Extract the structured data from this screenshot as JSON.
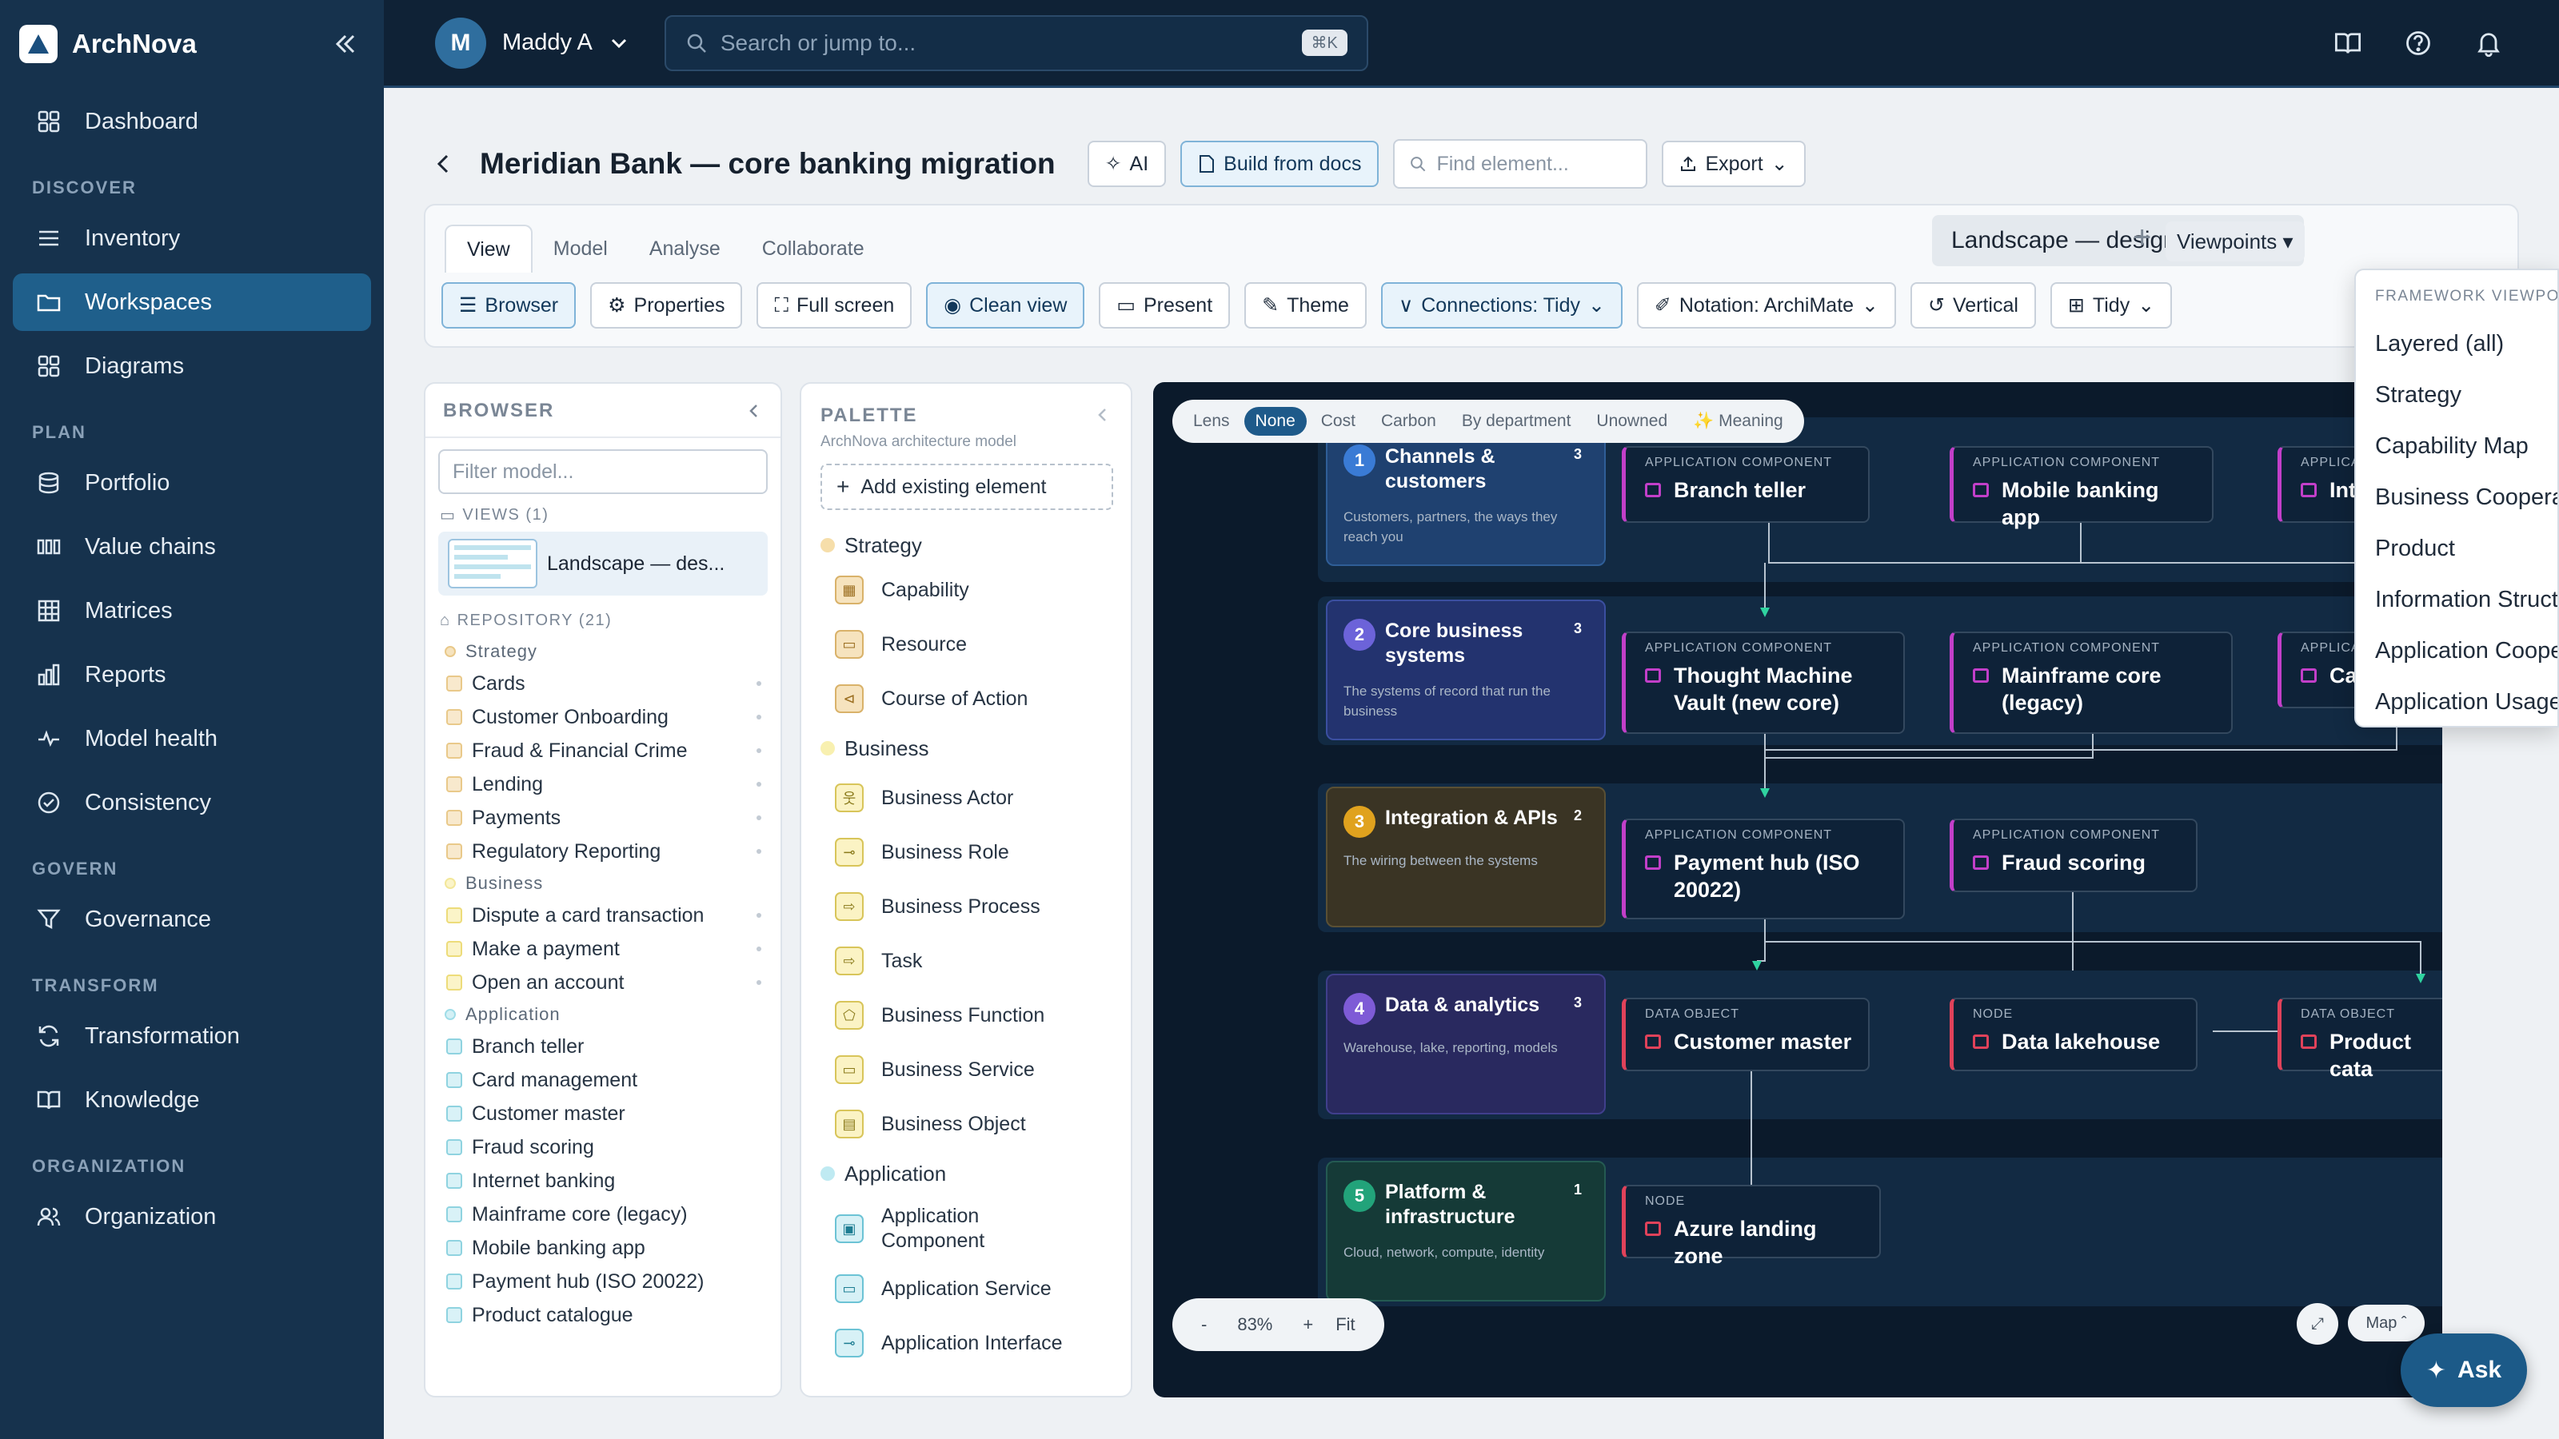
{
  "app": {
    "name": "ArchNova"
  },
  "sidebar": {
    "items_top": [
      {
        "label": "Dashboard",
        "icon": "dashboard-icon"
      }
    ],
    "sections": [
      {
        "title": "DISCOVER",
        "items": [
          {
            "label": "Inventory"
          },
          {
            "label": "Workspaces",
            "active": true
          },
          {
            "label": "Diagrams"
          }
        ]
      },
      {
        "title": "PLAN",
        "items": [
          {
            "label": "Portfolio"
          },
          {
            "label": "Value chains"
          },
          {
            "label": "Matrices"
          },
          {
            "label": "Reports"
          },
          {
            "label": "Model health"
          },
          {
            "label": "Consistency"
          }
        ]
      },
      {
        "title": "GOVERN",
        "items": [
          {
            "label": "Governance"
          }
        ]
      },
      {
        "title": "TRANSFORM",
        "items": [
          {
            "label": "Transformation"
          },
          {
            "label": "Knowledge"
          }
        ]
      },
      {
        "title": "ORGANIZATION",
        "items": [
          {
            "label": "Organization"
          }
        ]
      }
    ]
  },
  "topbar": {
    "avatar_initial": "M",
    "user": "Maddy A",
    "search_placeholder": "Search or jump to...",
    "shortcut": "⌘K"
  },
  "header": {
    "title": "Meridian Bank — core banking migration",
    "ai_label": "AI",
    "build_label": "Build from docs",
    "find_placeholder": "Find element...",
    "export_label": "Export"
  },
  "tabs": [
    "View",
    "Model",
    "Analyse",
    "Collaborate"
  ],
  "view_name": "Landscape — design reference",
  "viewpoints_label": "Viewpoints ▾",
  "toolbar": [
    "Browser",
    "Properties",
    "Full screen",
    "Clean view",
    "Present",
    "Theme",
    "Connections: Tidy",
    "Notation: ArchiMate",
    "Vertical",
    "Tidy"
  ],
  "browser": {
    "title": "BROWSER",
    "filter_placeholder": "Filter model...",
    "views_label": "VIEWS (1)",
    "view_item": "Landscape — des...",
    "repo_label": "REPOSITORY (21)",
    "groups": [
      {
        "name": "Strategy",
        "color": "#e9c98a",
        "items": [
          "Cards",
          "Customer Onboarding",
          "Fraud & Financial Crime",
          "Lending",
          "Payments",
          "Regulatory Reporting"
        ]
      },
      {
        "name": "Business",
        "color": "#f3e79a",
        "items": [
          "Dispute a card transaction",
          "Make a payment",
          "Open an account"
        ]
      },
      {
        "name": "Application",
        "color": "#9fdde8",
        "items": [
          "Branch teller",
          "Card management",
          "Customer master",
          "Fraud scoring",
          "Internet banking",
          "Mainframe core (legacy)",
          "Mobile banking app",
          "Payment hub (ISO 20022)",
          "Product catalogue"
        ]
      }
    ]
  },
  "palette": {
    "title": "PALETTE",
    "subtitle": "ArchNova architecture model",
    "add_label": "Add existing element",
    "groups": [
      {
        "name": "Strategy",
        "color": "#e9c98a",
        "items": [
          "Capability",
          "Resource",
          "Course of Action"
        ]
      },
      {
        "name": "Business",
        "color": "#f3e79a",
        "items": [
          "Business Actor",
          "Business Role",
          "Business Process",
          "Task",
          "Business Function",
          "Business Service",
          "Business Object"
        ]
      },
      {
        "name": "Application",
        "color": "#9fdde8",
        "items": [
          "Application Component",
          "Application Service",
          "Application Interface"
        ]
      }
    ]
  },
  "lens": {
    "label": "Lens",
    "options": [
      "None",
      "Cost",
      "Carbon",
      "By department",
      "Unowned",
      "✨ Meaning"
    ],
    "active": "None"
  },
  "lanes": [
    {
      "num": "1",
      "title": "Channels & customers",
      "count": "3",
      "desc": "Customers, partners, the ways they reach you",
      "color": "#2a4f8a",
      "num_color": "#3a7bd5"
    },
    {
      "num": "2",
      "title": "Core business systems",
      "count": "3",
      "desc": "The systems of record that run the business",
      "color": "#2d3f88",
      "num_color": "#6c63d9"
    },
    {
      "num": "3",
      "title": "Integration & APIs",
      "count": "2",
      "desc": "The wiring between the systems",
      "color": "#3b3628",
      "num_color": "#e0a21e"
    },
    {
      "num": "4",
      "title": "Data & analytics",
      "count": "3",
      "desc": "Warehouse, lake, reporting, models",
      "color": "#2e2f6e",
      "num_color": "#7e5bd6"
    },
    {
      "num": "5",
      "title": "Platform & infrastructure",
      "count": "1",
      "desc": "Cloud, network, compute, identity",
      "color": "#173f3a",
      "num_color": "#22a37a"
    }
  ],
  "nodes": [
    {
      "kind": "APPLICATION COMPONENT",
      "name": "Branch teller"
    },
    {
      "kind": "APPLICATION COMPONENT",
      "name": "Mobile banking app"
    },
    {
      "kind": "APPLICA",
      "name": "Int"
    },
    {
      "kind": "APPLICATION COMPONENT",
      "name": "Thought Machine Vault (new core)"
    },
    {
      "kind": "APPLICATION COMPONENT",
      "name": "Mainframe core (legacy)"
    },
    {
      "kind": "APPLICA",
      "name": "Ca"
    },
    {
      "kind": "APPLICATION COMPONENT",
      "name": "Payment hub (ISO 20022)"
    },
    {
      "kind": "APPLICATION COMPONENT",
      "name": "Fraud scoring"
    },
    {
      "kind": "DATA OBJECT",
      "name": "Customer master"
    },
    {
      "kind": "NODE",
      "name": "Data lakehouse"
    },
    {
      "kind": "DATA OBJECT",
      "name": "Product cata"
    },
    {
      "kind": "NODE",
      "name": "Azure landing zone"
    }
  ],
  "zoom": {
    "minus": "-",
    "level": "83%",
    "plus": "+",
    "fit": "Fit"
  },
  "map_label": "Map ˆ",
  "dropdown": {
    "header": "FRAMEWORK VIEWPOINTS",
    "items": [
      "Layered (all)",
      "Strategy",
      "Capability Map",
      "Business Cooperation",
      "Product",
      "Information Structure",
      "Application Cooperation",
      "Application Usage"
    ]
  },
  "ask_label": "Ask"
}
